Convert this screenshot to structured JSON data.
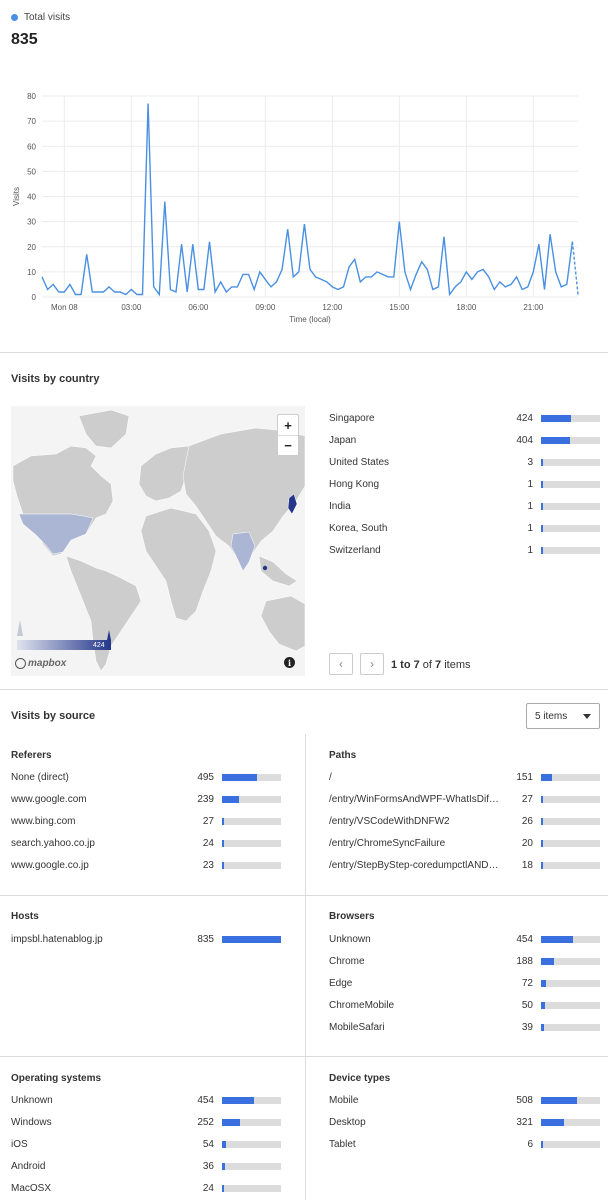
{
  "total_visits": {
    "legend_label": "Total visits",
    "total": "835",
    "color": "#4a90e2"
  },
  "chart_data": {
    "type": "line",
    "xlabel": "Time (local)",
    "ylabel": "Visits",
    "ylim": [
      0,
      80
    ],
    "y_ticks": [
      "0",
      "10",
      "20",
      "30",
      "40",
      "50",
      "60",
      "70",
      "80"
    ],
    "x_tick_labels": [
      "Mon 08",
      "03:00",
      "06:00",
      "09:00",
      "12:00",
      "15:00",
      "18:00",
      "21:00"
    ],
    "interval_minutes": 15,
    "values": [
      8,
      3,
      5,
      2,
      2,
      5,
      1,
      1,
      17,
      2,
      2,
      2,
      4,
      2,
      2,
      1,
      3,
      1,
      1,
      77,
      4,
      1,
      38,
      3,
      2,
      21,
      2,
      21,
      3,
      3,
      22,
      2,
      6,
      2,
      4,
      4,
      9,
      9,
      3,
      10,
      7,
      4,
      6,
      11,
      27,
      8,
      10,
      29,
      11,
      8,
      7,
      6,
      4,
      3,
      4,
      12,
      15,
      6,
      8,
      8,
      10,
      9,
      8,
      8,
      30,
      10,
      3,
      9,
      14,
      11,
      3,
      4,
      24,
      1,
      4,
      6,
      10,
      7,
      10,
      11,
      8,
      3,
      6,
      4,
      5,
      8,
      3,
      4,
      10,
      21,
      3,
      25,
      10,
      4,
      5,
      22,
      1
    ],
    "last_segment_dashed": true
  },
  "visits_by_country": {
    "title": "Visits by country",
    "items": [
      {
        "name": "Singapore",
        "count": "424",
        "ratio": 0.509
      },
      {
        "name": "Japan",
        "count": "404",
        "ratio": 0.484
      },
      {
        "name": "United States",
        "count": "3",
        "ratio": 0.004
      },
      {
        "name": "Hong Kong",
        "count": "1",
        "ratio": 0.001
      },
      {
        "name": "India",
        "count": "1",
        "ratio": 0.001
      },
      {
        "name": "Korea, South",
        "count": "1",
        "ratio": 0.001
      },
      {
        "name": "Switzerland",
        "count": "1",
        "ratio": 0.001
      }
    ],
    "map": {
      "zoom_in": "+",
      "zoom_out": "−",
      "legend_max": "424",
      "attribution": "mapbox",
      "info_icon": "info-icon"
    },
    "pager": {
      "prev_icon": "‹",
      "next_icon": "›",
      "range": "1 to 7",
      "of": "of",
      "total": "7",
      "items_word": "items"
    }
  },
  "visits_by_source": {
    "title": "Visits by source",
    "select_value": "5 items",
    "referers": {
      "title": "Referers",
      "items": [
        {
          "name": "None (direct)",
          "count": "495",
          "ratio": 0.593
        },
        {
          "name": "www.google.com",
          "count": "239",
          "ratio": 0.286
        },
        {
          "name": "www.bing.com",
          "count": "27",
          "ratio": 0.032
        },
        {
          "name": "search.yahoo.co.jp",
          "count": "24",
          "ratio": 0.029
        },
        {
          "name": "www.google.co.jp",
          "count": "23",
          "ratio": 0.028
        }
      ]
    },
    "paths": {
      "title": "Paths",
      "items": [
        {
          "name": "/",
          "count": "151",
          "ratio": 0.181
        },
        {
          "name": "/entry/WinFormsAndWPF-WhatIsDiffe...",
          "count": "27",
          "ratio": 0.032
        },
        {
          "name": "/entry/VSCodeWithDNFW2",
          "count": "26",
          "ratio": 0.031
        },
        {
          "name": "/entry/ChromeSyncFailure",
          "count": "20",
          "ratio": 0.024
        },
        {
          "name": "/entry/StepByStep-coredumpctlANDg...",
          "count": "18",
          "ratio": 0.022
        }
      ]
    },
    "hosts": {
      "title": "Hosts",
      "items": [
        {
          "name": "impsbl.hatenablog.jp",
          "count": "835",
          "ratio": 1.0
        }
      ]
    },
    "browsers": {
      "title": "Browsers",
      "items": [
        {
          "name": "Unknown",
          "count": "454",
          "ratio": 0.544
        },
        {
          "name": "Chrome",
          "count": "188",
          "ratio": 0.225
        },
        {
          "name": "Edge",
          "count": "72",
          "ratio": 0.086
        },
        {
          "name": "ChromeMobile",
          "count": "50",
          "ratio": 0.06
        },
        {
          "name": "MobileSafari",
          "count": "39",
          "ratio": 0.047
        }
      ]
    },
    "operating_systems": {
      "title": "Operating systems",
      "items": [
        {
          "name": "Unknown",
          "count": "454",
          "ratio": 0.544
        },
        {
          "name": "Windows",
          "count": "252",
          "ratio": 0.302
        },
        {
          "name": "iOS",
          "count": "54",
          "ratio": 0.065
        },
        {
          "name": "Android",
          "count": "36",
          "ratio": 0.043
        },
        {
          "name": "MacOSX",
          "count": "24",
          "ratio": 0.029
        }
      ]
    },
    "device_types": {
      "title": "Device types",
      "items": [
        {
          "name": "Mobile",
          "count": "508",
          "ratio": 0.608
        },
        {
          "name": "Desktop",
          "count": "321",
          "ratio": 0.384
        },
        {
          "name": "Tablet",
          "count": "6",
          "ratio": 0.007
        }
      ]
    }
  },
  "colors": {
    "bar_fill": "#3a6fe0",
    "bar_track": "#dcdcdc",
    "line": "#4a90e2"
  }
}
